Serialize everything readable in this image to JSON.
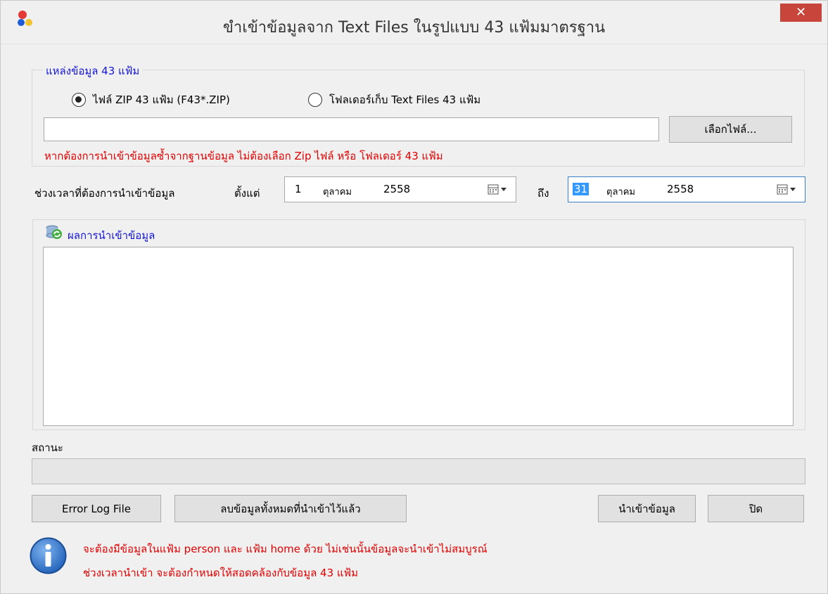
{
  "window": {
    "title": "ขำเข้าข้อมูลจาก Text Files ในรูปแบบ 43 แฟ้มมาตรฐาน",
    "close_label": "✕"
  },
  "source_group": {
    "legend": "แหล่งข้อมูล 43 แฟ้ม",
    "radio_zip_label": "ไฟล์ ZIP 43 แฟ้ม (F43*.ZIP)",
    "radio_folder_label": "โฟลเดอร์เก็บ Text Files 43 แฟ้ม",
    "selected": "zip",
    "path_value": "",
    "browse_label": "เลือกไฟล์...",
    "note": "หากต้องการนำเข้าข้อมูลซ้ำจากฐานข้อมูล ไม่ต้องเลือก Zip ไฟล์ หรือ โฟลเดอร์ 43 แฟ้ม"
  },
  "period": {
    "label": "ช่วงเวลาที่ต้องการนำเข้าข้อมูล",
    "from_label": "ตั้งแต่",
    "to_label": "ถึง",
    "from": {
      "day": "1",
      "month": "ตุลาคม",
      "year": "2558"
    },
    "to": {
      "day": "31",
      "month": "ตุลาคม",
      "year": "2558"
    }
  },
  "results": {
    "title": "ผลการนำเข้าข้อมูล",
    "content": ""
  },
  "status": {
    "label": "สถานะ",
    "value": ""
  },
  "buttons": {
    "error_log": "Error Log File",
    "delete_all": "ลบข้อมูลทั้งหมดที่นำเข้าไว้แล้ว",
    "import": "นำเข้าข้อมูล",
    "close": "ปิด"
  },
  "info": {
    "line1": "จะต้องมีข้อมูลในแฟ้ม person และ แฟ้ม home ด้วย ไม่เช่นนั้นข้อมูลจะนำเข้าไม่สมบูรณ์",
    "line2": "ช่วงเวลานำเข้า จะต้องกำหนดให้สอดคล้องกับข้อมูล 43 แฟ้ม"
  },
  "colors": {
    "accent_blue": "#1515d8",
    "warning_red": "#e00000",
    "close_red": "#c7453b"
  }
}
